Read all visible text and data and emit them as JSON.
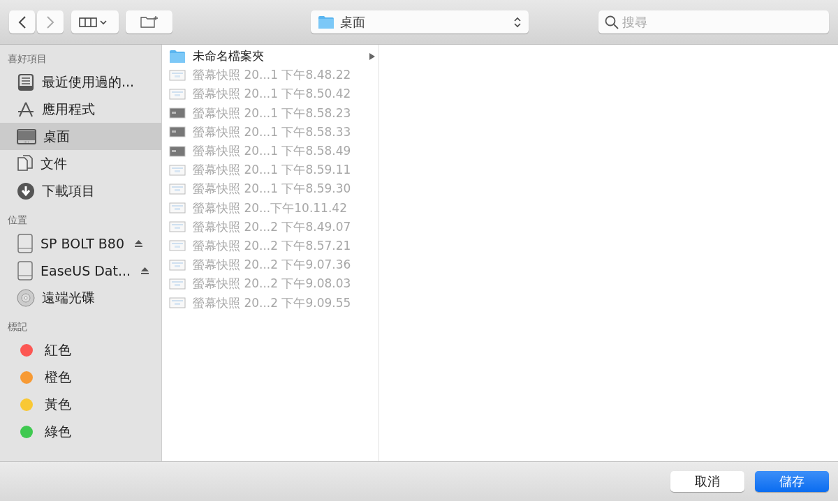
{
  "toolbar": {
    "nav": [
      {
        "kind": "back",
        "disabled": false
      },
      {
        "kind": "forward",
        "disabled": true
      }
    ],
    "location": {
      "title": "桌面"
    },
    "search": {
      "placeholder": "搜尋"
    }
  },
  "sidebar": {
    "sections": [
      {
        "heading": "喜好項目",
        "items": [
          {
            "label": "最近使用過的...",
            "kind": "recents",
            "selected": false
          },
          {
            "label": "應用程式",
            "kind": "apps",
            "selected": false
          },
          {
            "label": "桌面",
            "kind": "desktop",
            "selected": true
          },
          {
            "label": "文件",
            "kind": "documents",
            "selected": false
          },
          {
            "label": "下載項目",
            "kind": "downloads",
            "selected": false
          }
        ]
      },
      {
        "heading": "位置",
        "items": [
          {
            "label": "SP BOLT B80",
            "kind": "drive",
            "ejectable": true,
            "selected": false
          },
          {
            "label": "EaseUS Dat...",
            "kind": "drive",
            "ejectable": true,
            "selected": false
          },
          {
            "label": "遠端光碟",
            "kind": "disc",
            "ejectable": false,
            "selected": false
          }
        ]
      },
      {
        "heading": "標記",
        "items": [
          {
            "label": "紅色",
            "kind": "tag",
            "color": "#fc5753",
            "selected": false
          },
          {
            "label": "橙色",
            "kind": "tag",
            "color": "#f79a34",
            "selected": false
          },
          {
            "label": "黃色",
            "kind": "tag",
            "color": "#f9c834",
            "selected": false
          },
          {
            "label": "綠色",
            "kind": "tag",
            "color": "#3fc950",
            "selected": false
          }
        ]
      }
    ]
  },
  "files": [
    {
      "name": "未命名檔案夾",
      "kind": "folder",
      "disabled": false
    },
    {
      "name": "螢幕快照 20...1 下午8.48.22",
      "kind": "light",
      "disabled": true
    },
    {
      "name": "螢幕快照 20...1 下午8.50.42",
      "kind": "light",
      "disabled": true
    },
    {
      "name": "螢幕快照 20...1 下午8.58.23",
      "kind": "dark",
      "disabled": true
    },
    {
      "name": "螢幕快照 20...1 下午8.58.33",
      "kind": "dark",
      "disabled": true
    },
    {
      "name": "螢幕快照 20...1 下午8.58.49",
      "kind": "dark",
      "disabled": true
    },
    {
      "name": "螢幕快照 20...1 下午8.59.11",
      "kind": "light",
      "disabled": true
    },
    {
      "name": "螢幕快照 20...1 下午8.59.30",
      "kind": "light",
      "disabled": true
    },
    {
      "name": "螢幕快照 20...下午10.11.42",
      "kind": "light",
      "disabled": true
    },
    {
      "name": "螢幕快照 20...2 下午8.49.07",
      "kind": "light",
      "disabled": true
    },
    {
      "name": "螢幕快照 20...2 下午8.57.21",
      "kind": "light",
      "disabled": true
    },
    {
      "name": "螢幕快照 20...2 下午9.07.36",
      "kind": "light",
      "disabled": true
    },
    {
      "name": "螢幕快照 20...2 下午9.08.03",
      "kind": "light",
      "disabled": true
    },
    {
      "name": "螢幕快照 20...2 下午9.09.55",
      "kind": "light",
      "disabled": true
    }
  ],
  "buttons": [
    {
      "label": "取消",
      "kind": "cancel"
    },
    {
      "label": "儲存",
      "kind": "default"
    }
  ]
}
